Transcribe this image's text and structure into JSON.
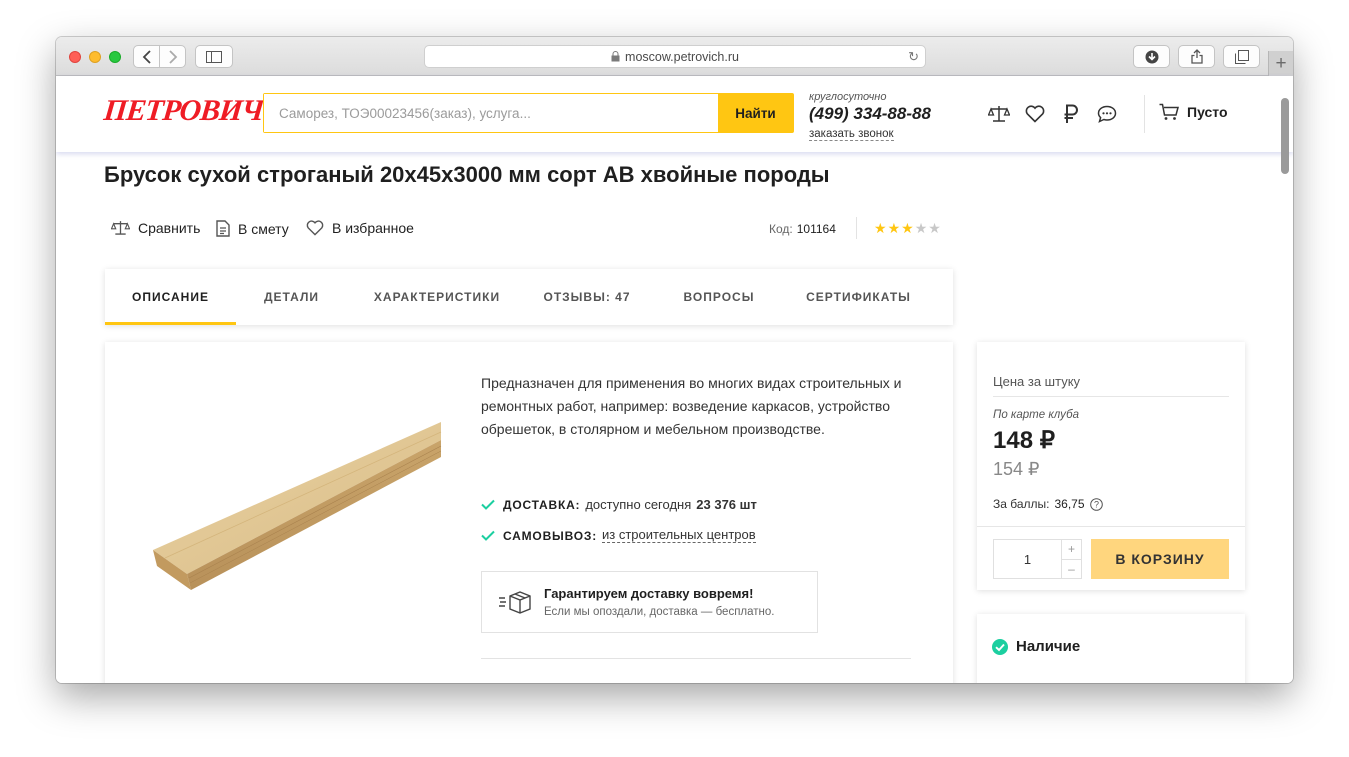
{
  "browser": {
    "url": "moscow.petrovich.ru",
    "new_tab_label": "+"
  },
  "header": {
    "logo": "Петрович",
    "search_placeholder": "Саморез, ТОЭ00023456(заказ), услуга...",
    "search_button": "Найти",
    "phone_note": "круглосуточно",
    "phone": "(499) 334-88-88",
    "callback": "заказать звонок",
    "cart_label": "Пусто",
    "icons": [
      "scales-icon",
      "heart-icon",
      "ruble-icon",
      "chat-icon",
      "cart-icon"
    ]
  },
  "product": {
    "title": "Брусок сухой строганый 20х45х3000 мм сорт АВ хвойные породы",
    "actions": {
      "compare": "Сравнить",
      "estimate": "В смету",
      "favorite": "В избранное"
    },
    "code_label": "Код:",
    "code": "101164",
    "rating": 3,
    "rating_max": 5
  },
  "tabs": [
    {
      "label": "ОПИСАНИЕ",
      "active": true
    },
    {
      "label": "ДЕТАЛИ",
      "active": false
    },
    {
      "label": "ХАРАКТЕРИСТИКИ",
      "active": false
    },
    {
      "label": "ОТЗЫВЫ: 47",
      "active": false
    },
    {
      "label": "ВОПРОСЫ",
      "active": false
    },
    {
      "label": "СЕРТИФИКАТЫ",
      "active": false
    }
  ],
  "description": {
    "text": "Предназначен для применения во многих видах строительных и ремонтных работ, например: возведение каркасов, устройство обрешеток, в столярном и мебельном производстве.",
    "delivery_label": "ДОСТАВКА:",
    "delivery_text": "доступно сегодня",
    "delivery_qty": "23 376 шт",
    "pickup_label": "САМОВЫВОЗ:",
    "pickup_text": "из строительных центров",
    "guarantee_title": "Гарантируем доставку вовремя!",
    "guarantee_sub": "Если мы опоздали, доставка — бесплатно."
  },
  "price": {
    "label": "Цена за штуку",
    "club_label": "По карте клуба",
    "club_price": "148 ₽",
    "regular_price": "154 ₽",
    "points_label": "За баллы:",
    "points_value": "36,75",
    "quantity": "1",
    "plus": "+",
    "minus": "–",
    "add_to_cart": "В КОРЗИНУ"
  },
  "availability": {
    "title": "Наличие"
  },
  "colors": {
    "brand_red": "#ef1c25",
    "accent_yellow": "#ffc612",
    "cart_button": "#ffd67e",
    "check_green": "#1ccfa0",
    "star_filled": "#ffc612",
    "star_empty": "#c8c8c8"
  }
}
